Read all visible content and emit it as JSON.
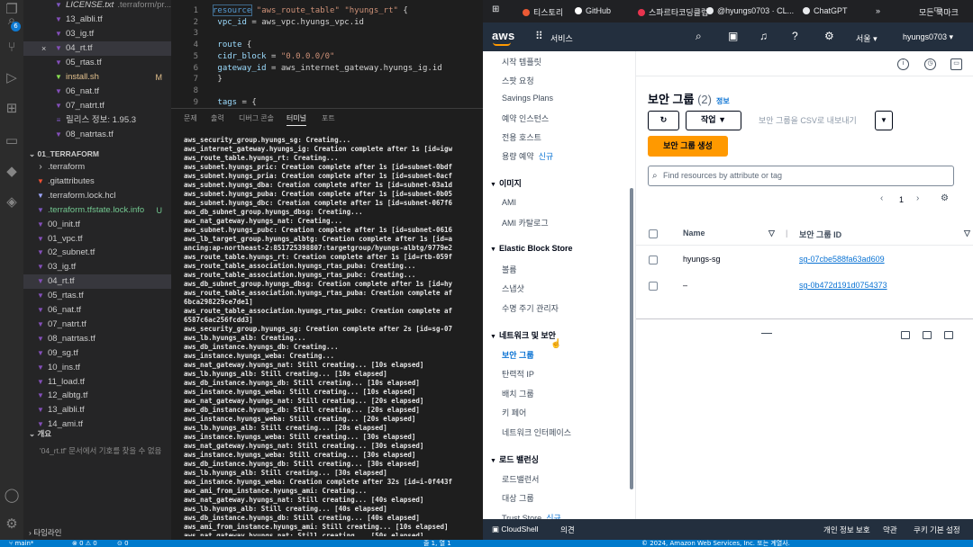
{
  "vscode": {
    "explorer": {
      "top_items": [
        {
          "label": "LICENSE.txt",
          "extra": ".terraform/pr...",
          "icon": "license-icon",
          "italic": true
        },
        {
          "label": "13_albli.tf",
          "icon": "terraform-file-icon"
        },
        {
          "label": "03_ig.tf",
          "icon": "terraform-file-icon"
        },
        {
          "label": "04_rt.tf",
          "icon": "terraform-file-icon",
          "active": true,
          "close": "×"
        },
        {
          "label": "05_rtas.tf",
          "icon": "terraform-file-icon"
        },
        {
          "label": "install.sh",
          "badge": "M",
          "icon": "shell-file-icon"
        },
        {
          "label": "06_nat.tf",
          "icon": "terraform-file-icon"
        },
        {
          "label": "07_natrt.tf",
          "icon": "terraform-file-icon"
        },
        {
          "label": "릴리스 정보: 1.95.3",
          "icon": "release-notes-icon"
        },
        {
          "label": "08_natrtas.tf",
          "icon": "terraform-file-icon"
        }
      ],
      "folder_title": "01_TERRAFORM",
      "folder_items": [
        {
          "label": ".terraform",
          "icon": "chevron-right-icon"
        },
        {
          "label": ".gitattributes",
          "icon": "git-file-icon"
        },
        {
          "label": ".terraform.lock.hcl",
          "icon": "hcl-file-icon"
        },
        {
          "label": ".terraform.tfstate.lock.info",
          "badge": "U",
          "icon": "info-file-icon",
          "green": true
        },
        {
          "label": "00_init.tf",
          "icon": "terraform-file-icon"
        },
        {
          "label": "01_vpc.tf",
          "icon": "terraform-file-icon"
        },
        {
          "label": "02_subnet.tf",
          "icon": "terraform-file-icon"
        },
        {
          "label": "03_ig.tf",
          "icon": "terraform-file-icon"
        },
        {
          "label": "04_rt.tf",
          "icon": "terraform-file-icon",
          "active": true
        },
        {
          "label": "05_rtas.tf",
          "icon": "terraform-file-icon"
        },
        {
          "label": "06_nat.tf",
          "icon": "terraform-file-icon"
        },
        {
          "label": "07_natrt.tf",
          "icon": "terraform-file-icon"
        },
        {
          "label": "08_natrtas.tf",
          "icon": "terraform-file-icon"
        },
        {
          "label": "09_sg.tf",
          "icon": "terraform-file-icon"
        },
        {
          "label": "10_ins.tf",
          "icon": "terraform-file-icon"
        },
        {
          "label": "11_load.tf",
          "icon": "terraform-file-icon"
        },
        {
          "label": "12_albtg.tf",
          "icon": "terraform-file-icon"
        },
        {
          "label": "13_albli.tf",
          "icon": "terraform-file-icon"
        },
        {
          "label": "14_ami.tf",
          "icon": "terraform-file-icon"
        }
      ],
      "outline_title": "개요",
      "outline_message": "'04_rt.tf' 문서에서 기호를 찾을 수 없음",
      "timeline_title": "타임라인"
    },
    "activity_badge": "6",
    "code_lines": [
      {
        "n": "1",
        "html": [
          {
            "c": "kw",
            "t": "resource "
          },
          {
            "c": "str",
            "t": "\"aws_route_table\" \"hyungs_rt\""
          },
          {
            "c": "pl",
            "t": " {"
          }
        ]
      },
      {
        "n": "2",
        "html": [
          {
            "c": "attr",
            "t": "  vpc_id"
          },
          {
            "c": "pl",
            "t": " = aws_vpc.hyungs_vpc.id"
          }
        ]
      },
      {
        "n": "3",
        "html": []
      },
      {
        "n": "4",
        "html": [
          {
            "c": "attr",
            "t": "  route"
          },
          {
            "c": "pl",
            "t": " {"
          }
        ]
      },
      {
        "n": "5",
        "html": [
          {
            "c": "attr",
            "t": "    cidr_block"
          },
          {
            "c": "pl",
            "t": " = "
          },
          {
            "c": "str",
            "t": "\"0.0.0.0/0\""
          }
        ]
      },
      {
        "n": "6",
        "html": [
          {
            "c": "attr",
            "t": "    gateway_id"
          },
          {
            "c": "pl",
            "t": " = aws_internet_gateway.hyungs_ig.id"
          }
        ]
      },
      {
        "n": "7",
        "html": [
          {
            "c": "pl",
            "t": "  }"
          }
        ]
      },
      {
        "n": "8",
        "html": []
      },
      {
        "n": "9",
        "html": [
          {
            "c": "attr",
            "t": "  tags"
          },
          {
            "c": "pl",
            "t": " = {"
          }
        ]
      }
    ],
    "panel_tabs": [
      "문제",
      "출력",
      "디버그 콘솔",
      "터미널",
      "포트"
    ],
    "active_panel_tab": 3,
    "terminal_lines": [
      "aws_security_group.hyungs_sg: Creating...",
      "aws_internet_gateway.hyungs_ig: Creation complete after 1s [id=igw",
      "aws_route_table.hyungs_rt: Creating...",
      "aws_subnet.hyungs_pric: Creation complete after 1s [id=subnet-0bdf",
      "aws_subnet.hyungs_pria: Creation complete after 1s [id=subnet-0acf",
      "aws_subnet.hyungs_dba: Creation complete after 1s [id=subnet-03a1d",
      "aws_subnet.hyungs_puba: Creation complete after 1s [id=subnet-0b05",
      "aws_subnet.hyungs_dbc: Creation complete after 1s [id=subnet-067f6",
      "aws_db_subnet_group.hyungs_dbsg: Creating...",
      "aws_nat_gateway.hyungs_nat: Creating...",
      "aws_subnet.hyungs_pubc: Creation complete after 1s [id=subnet-0616",
      "aws_lb_target_group.hyungs_albtg: Creation complete after 1s [id=a",
      "ancing:ap-northeast-2:851725398807:targetgroup/hyungs-albtg/9779e2",
      "aws_route_table.hyungs_rt: Creation complete after 1s [id=rtb-059f",
      "aws_route_table_association.hyungs_rtas_puba: Creating...",
      "aws_route_table_association.hyungs_rtas_pubc: Creating...",
      "aws_db_subnet_group.hyungs_dbsg: Creation complete after 1s [id=hy",
      "aws_route_table_association.hyungs_rtas_puba: Creation complete af",
      "6bca298229ce7de1]",
      "aws_route_table_association.hyungs_rtas_pubc: Creation complete af",
      "6587c6ac256fcdd3]",
      "aws_security_group.hyungs_sg: Creation complete after 2s [id=sg-07",
      "aws_lb.hyungs_alb: Creating...",
      "aws_db_instance.hyungs_db: Creating...",
      "aws_instance.hyungs_weba: Creating...",
      "aws_nat_gateway.hyungs_nat: Still creating... [10s elapsed]",
      "aws_lb.hyungs_alb: Still creating... [10s elapsed]",
      "aws_db_instance.hyungs_db: Still creating... [10s elapsed]",
      "aws_instance.hyungs_weba: Still creating... [10s elapsed]",
      "aws_nat_gateway.hyungs_nat: Still creating... [20s elapsed]",
      "aws_db_instance.hyungs_db: Still creating... [20s elapsed]",
      "aws_instance.hyungs_weba: Still creating... [20s elapsed]",
      "aws_lb.hyungs_alb: Still creating... [20s elapsed]",
      "aws_instance.hyungs_weba: Still creating... [30s elapsed]",
      "aws_nat_gateway.hyungs_nat: Still creating... [30s elapsed]",
      "aws_instance.hyungs_weba: Still creating... [30s elapsed]",
      "aws_db_instance.hyungs_db: Still creating... [30s elapsed]",
      "aws_lb.hyungs_alb: Still creating... [30s elapsed]",
      "aws_instance.hyungs_weba: Creation complete after 32s [id=i-0f443f",
      "aws_ami_from_instance.hyungs_ami: Creating...",
      "aws_nat_gateway.hyungs_nat: Still creating... [40s elapsed]",
      "aws_lb.hyungs_alb: Still creating... [40s elapsed]",
      "aws_db_instance.hyungs_db: Still creating... [40s elapsed]",
      "aws_ami_from_instance.hyungs_ami: Still creating... [10s elapsed]",
      "aws_nat_gateway.hyungs_nat: Still creating... [50s elapsed]"
    ],
    "status": {
      "branch": "main*",
      "errors": "0",
      "warnings": "0",
      "ports": "0",
      "position": "줄 1, 열 1"
    }
  },
  "browser": {
    "bookmarks": [
      {
        "label": "티스토리",
        "color": "#eb5a35"
      },
      {
        "label": "GitHub",
        "color": "#ffffff"
      },
      {
        "label": "스파르타코딩클럽",
        "color": "#e8344e"
      },
      {
        "label": "@hyungs0703 · CL...",
        "color": "#e8eaed"
      },
      {
        "label": "ChatGPT",
        "color": "#e8eaed"
      }
    ],
    "bookmarks_overflow": "»",
    "all_bookmarks": "모든 북마크",
    "aws": {
      "logo": "aws",
      "services": "서비스",
      "region": "서울",
      "account": "hyungs0703"
    }
  },
  "sidebar": {
    "items": [
      {
        "type": "item",
        "label": "시작 템플릿"
      },
      {
        "type": "item",
        "label": "스팟 요청"
      },
      {
        "type": "item",
        "label": "Savings Plans"
      },
      {
        "type": "item",
        "label": "예약 인스턴스"
      },
      {
        "type": "item",
        "label": "전용 호스트"
      },
      {
        "type": "item",
        "label": "용량 예약",
        "new": "신규"
      },
      {
        "type": "head",
        "label": "이미지"
      },
      {
        "type": "item",
        "label": "AMI"
      },
      {
        "type": "item",
        "label": "AMI 카탈로그"
      },
      {
        "type": "head",
        "label": "Elastic Block Store"
      },
      {
        "type": "item",
        "label": "볼륨"
      },
      {
        "type": "item",
        "label": "스냅샷"
      },
      {
        "type": "item",
        "label": "수명 주기 관리자"
      },
      {
        "type": "head",
        "label": "네트워크 및 보안"
      },
      {
        "type": "item",
        "label": "보안 그룹",
        "selected": true
      },
      {
        "type": "item",
        "label": "탄력적 IP"
      },
      {
        "type": "item",
        "label": "배치 그룹"
      },
      {
        "type": "item",
        "label": "키 페어"
      },
      {
        "type": "item",
        "label": "네트워크 인터페이스"
      },
      {
        "type": "head",
        "label": "로드 밸런싱"
      },
      {
        "type": "item",
        "label": "로드밸런서"
      },
      {
        "type": "item",
        "label": "대상 그룹"
      },
      {
        "type": "item",
        "label": "Trust Store",
        "new": "신규"
      }
    ]
  },
  "content": {
    "title": "보안 그룹",
    "count": "(2)",
    "info": "정보",
    "actions_label": "작업",
    "export_label": "보안 그룹을 CSV로 내보내기",
    "create_label": "보안 그룹 생성",
    "search_placeholder": "Find resources by attribute or tag",
    "page": "1",
    "columns": [
      "Name",
      "보안 그룹 ID"
    ],
    "rows": [
      {
        "name": "hyungs-sg",
        "id": "sg-07cbe588fa63ad609"
      },
      {
        "name": "–",
        "id": "sg-0b472d191d0754373"
      }
    ]
  },
  "footer": {
    "cloudshell": "CloudShell",
    "feedback": "의견",
    "privacy": "개인 정보 보호",
    "terms": "약관",
    "cookies": "쿠키 기본 설정",
    "copyright": "© 2024, Amazon Web Services, Inc. 또는 계열사."
  }
}
